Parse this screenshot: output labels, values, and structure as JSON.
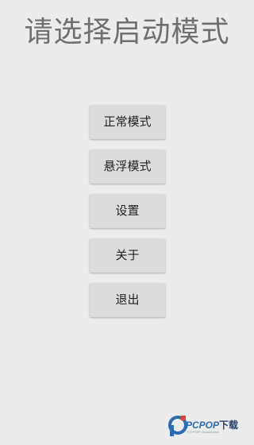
{
  "title": "请选择启动模式",
  "menu": {
    "items": [
      {
        "label": "正常模式"
      },
      {
        "label": "悬浮模式"
      },
      {
        "label": "设置"
      },
      {
        "label": "关于"
      },
      {
        "label": "退出"
      }
    ]
  },
  "watermark": {
    "brand": "PCPOP",
    "suffix": "下载",
    "sub": "PCPOP Download",
    "logo_icon": "pcpop-logo-icon",
    "color": "#2a6cb5"
  }
}
